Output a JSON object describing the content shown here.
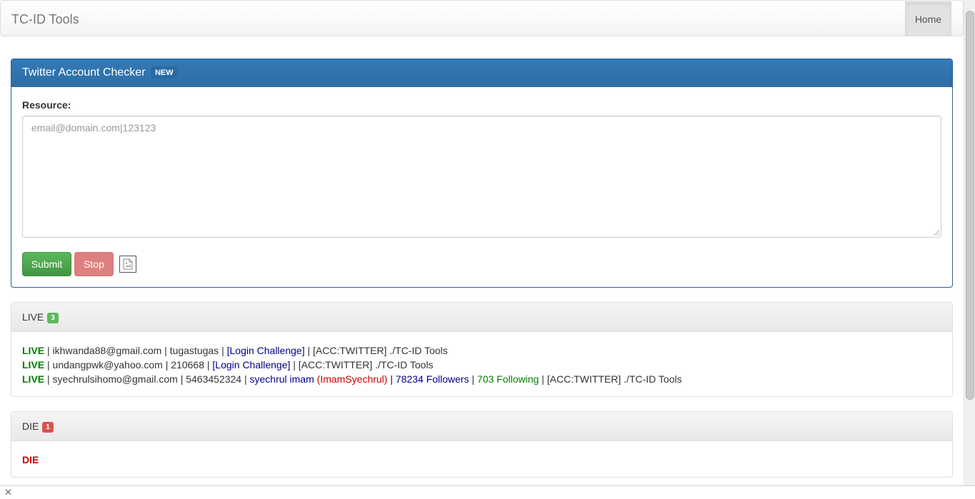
{
  "navbar": {
    "brand": "TC-ID Tools",
    "home": "Home"
  },
  "checker": {
    "title": "Twitter Account Checker",
    "badge": "NEW",
    "resource_label": "Resource:",
    "placeholder": "email@domain.com|123123",
    "submit": "Submit",
    "stop": "Stop"
  },
  "live": {
    "title": "LIVE",
    "count": "3",
    "rows": [
      {
        "status": "LIVE",
        "text1": " | ikhwanda88@gmail.com | tugastugas | ",
        "challenge": "[Login Challenge]",
        "text2": " | [ACC:TWITTER] ./TC-ID Tools"
      },
      {
        "status": "LIVE",
        "text1": " | undangpwk@yahoo.com | 210668 | ",
        "challenge": "[Login Challenge]",
        "text2": " | [ACC:TWITTER] ./TC-ID Tools"
      },
      {
        "status": "LIVE",
        "text1": " | syechrulsihomo@gmail.com | 5463452324 | ",
        "name": "syechrul imam",
        "handle": " (ImamSyechrul)",
        "sep1": " | ",
        "followers": "78234 Followers",
        "sep2": " | ",
        "following": "703 Following",
        "text2": " | [ACC:TWITTER] ./TC-ID Tools"
      }
    ]
  },
  "die": {
    "title": "DIE",
    "count": "1",
    "status": "DIE"
  },
  "colors": {
    "primary": "#337ab7",
    "success": "#5cb85c",
    "danger": "#d9534f"
  },
  "icons": {
    "broken_image": "broken-image-icon",
    "close": "close-icon"
  }
}
